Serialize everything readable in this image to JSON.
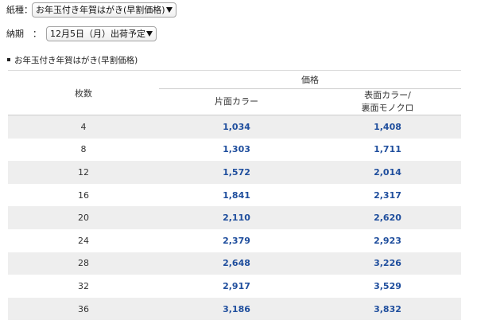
{
  "form": {
    "paper_type": {
      "label": "紙種：",
      "selected": "お年玉付き年賀はがき(早割価格)",
      "icon": "chevron-down-icon"
    },
    "delivery": {
      "label": "納期　：",
      "selected": "12月5日（月）出荷予定",
      "icon": "chevron-down-icon"
    }
  },
  "section": {
    "bullet_icon": "square-bullet-icon",
    "title": "お年玉付き年賀はがき(早割価格)"
  },
  "price_table": {
    "headers": {
      "quantity": "枚数",
      "price": "価格",
      "one_side_color": "片面カラー",
      "front_color_back_mono_line1": "表面カラー/",
      "front_color_back_mono_line2": "裏面モノクロ"
    },
    "rows": [
      {
        "quantity": "4",
        "one_side_color": "1,034",
        "front_color_back_mono": "1,408"
      },
      {
        "quantity": "8",
        "one_side_color": "1,303",
        "front_color_back_mono": "1,711"
      },
      {
        "quantity": "12",
        "one_side_color": "1,572",
        "front_color_back_mono": "2,014"
      },
      {
        "quantity": "16",
        "one_side_color": "1,841",
        "front_color_back_mono": "2,317"
      },
      {
        "quantity": "20",
        "one_side_color": "2,110",
        "front_color_back_mono": "2,620"
      },
      {
        "quantity": "24",
        "one_side_color": "2,379",
        "front_color_back_mono": "2,923"
      },
      {
        "quantity": "28",
        "one_side_color": "2,648",
        "front_color_back_mono": "3,226"
      },
      {
        "quantity": "32",
        "one_side_color": "2,917",
        "front_color_back_mono": "3,529"
      },
      {
        "quantity": "36",
        "one_side_color": "3,186",
        "front_color_back_mono": "3,832"
      }
    ]
  },
  "colors": {
    "price_text": "#1f4e9d",
    "stripe_background": "#eeeeee",
    "text": "#333333"
  }
}
